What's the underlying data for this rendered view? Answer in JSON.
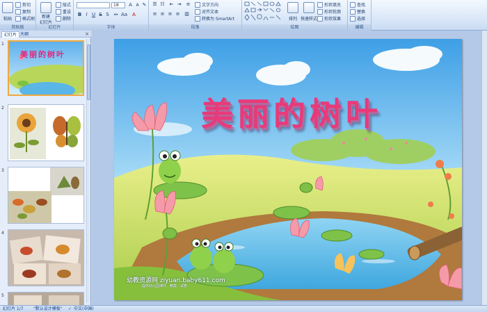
{
  "ribbon": {
    "clipboard": {
      "paste": "粘贴",
      "cut": "剪切",
      "copy": "复制",
      "format_painter": "格式刷",
      "label": "剪贴板"
    },
    "slides": {
      "new_slide": "新建",
      "new_slide_2": "幻灯片",
      "layout": "版式",
      "reset": "重设",
      "delete": "删除",
      "label": "幻灯片"
    },
    "font": {
      "font_name": "",
      "font_size": "18",
      "label": "字体"
    },
    "paragraph": {
      "text_direction": "文字方向",
      "align_text": "对齐文本",
      "smartart": "转换为 SmartArt",
      "label": "段落"
    },
    "drawing": {
      "arrange": "排列",
      "quick_styles": "快速样式",
      "shape_fill": "形状填充",
      "shape_outline": "形状轮廓",
      "shape_effects": "形状效果",
      "label": "绘图"
    },
    "editing": {
      "find": "查找",
      "replace": "替换",
      "select": "选择",
      "label": "编辑"
    }
  },
  "panel": {
    "tab_slides": "幻灯片",
    "tab_outline": "大纲",
    "close": "×",
    "thumbs": [
      {
        "num": "1",
        "title": "美丽的树叶"
      },
      {
        "num": "2"
      },
      {
        "num": "3"
      },
      {
        "num": "4"
      },
      {
        "num": "5"
      }
    ]
  },
  "slide": {
    "title": "美丽的树叶",
    "watermark": "幼教资源网 ziyuan.baby611.com",
    "watermark_sub": "提供幼儿园课件、教案、试卷"
  },
  "status": {
    "slide_info": "幻灯片 1/7",
    "theme": "\"默认设计模板\"",
    "language": "中文(中国)"
  },
  "colors": {
    "ribbon_bg": "#dbe8f8",
    "panel_bg": "#e4edf9",
    "selection": "#f0a83c"
  }
}
